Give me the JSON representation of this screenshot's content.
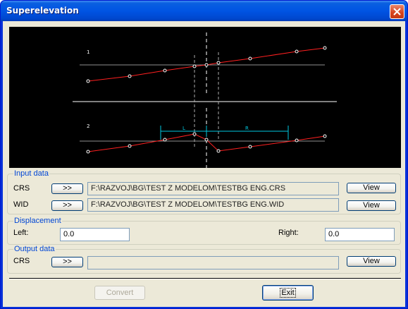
{
  "window": {
    "title": "Superelevation"
  },
  "preview": {
    "section1_label": "1",
    "section2_label": "2",
    "dim_left": "L",
    "dim_right": "R",
    "colors": {
      "profile": "#ff2020",
      "reference": "#909090",
      "dimension": "#00c8e0",
      "centerline": "#ffffff"
    }
  },
  "input_data": {
    "legend": "Input data",
    "crs_label": "CRS",
    "crs_browse": ">>",
    "crs_path": "F:\\RAZVOJ\\BG\\TEST Z MODELOM\\TESTBG ENG.CRS",
    "crs_view": "View",
    "wid_label": "WID",
    "wid_browse": ">>",
    "wid_path": "F:\\RAZVOJ\\BG\\TEST Z MODELOM\\TESTBG ENG.WID",
    "wid_view": "View"
  },
  "displacement": {
    "legend": "Displacement",
    "left_label": "Left:",
    "left_value": "0.0",
    "right_label": "Right:",
    "right_value": "0.0"
  },
  "output_data": {
    "legend": "Output data",
    "crs_label": "CRS",
    "crs_browse": ">>",
    "crs_path": "",
    "crs_view": "View"
  },
  "actions": {
    "convert": "Convert",
    "exit": "Exit"
  }
}
